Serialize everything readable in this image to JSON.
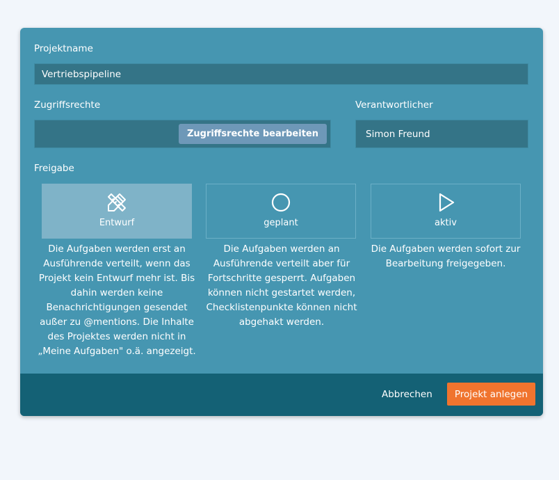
{
  "form": {
    "project_name_label": "Projektname",
    "project_name_value": "Vertriebspipeline",
    "access_label": "Zugriffsrechte",
    "access_button": "Zugriffsrechte bearbeiten",
    "owner_label": "Verantwortlicher",
    "owner_value": "Simon Freund",
    "release_label": "Freigabe"
  },
  "release_options": [
    {
      "label": "Entwurf",
      "icon": "pencil-ruler-icon",
      "selected": true,
      "description": "Die Aufgaben werden erst an Ausführende verteilt, wenn das Projekt kein Entwurf mehr ist. Bis dahin werden keine Benachrichtigungen gesendet außer zu @mentions. Die Inhalte des Projektes werden nicht in „Meine Aufgaben\" o.ä. angezeigt."
    },
    {
      "label": "geplant",
      "icon": "circle-icon",
      "selected": false,
      "description": "Die Aufgaben werden an Ausführende verteilt aber für Fortschritte gesperrt. Aufgaben können nicht gestartet werden, Checklistenpunkte können nicht abgehakt werden."
    },
    {
      "label": "aktiv",
      "icon": "play-icon",
      "selected": false,
      "description": "Die Aufgaben werden sofort zur Bearbeitung freigegeben."
    }
  ],
  "footer": {
    "cancel": "Abbrechen",
    "create": "Projekt anlegen"
  },
  "colors": {
    "page_background": "#f2f6fb",
    "dialog_background": "#4696b1",
    "field_background": "#347487",
    "selected_card": "#7fb3c8",
    "footer_background": "#146175",
    "primary_button": "#f0742e"
  }
}
